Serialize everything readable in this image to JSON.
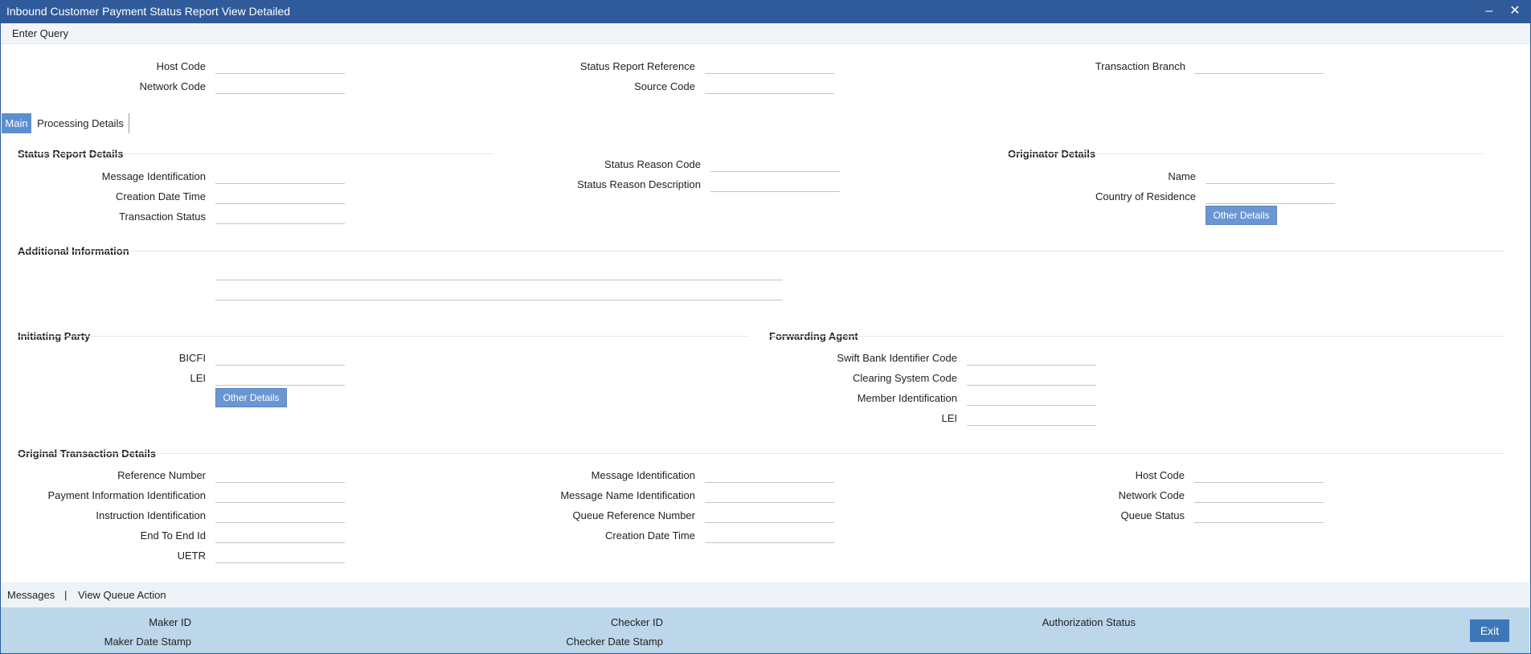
{
  "window": {
    "title": "Inbound Customer Payment Status Report View Detailed",
    "minimize_icon": "minimize-icon",
    "close_icon": "close-icon"
  },
  "menu": {
    "enter_query": "Enter Query"
  },
  "header": {
    "host_code": "Host Code",
    "network_code": "Network Code",
    "status_report_reference": "Status Report Reference",
    "source_code": "Source Code",
    "transaction_branch": "Transaction Branch"
  },
  "tabs": {
    "main": "Main",
    "processing_details": "Processing Details"
  },
  "status_report": {
    "title": "Status Report Details",
    "message_identification": "Message Identification",
    "creation_date_time": "Creation Date Time",
    "transaction_status": "Transaction Status",
    "status_reason_code": "Status Reason Code",
    "status_reason_description": "Status Reason Description"
  },
  "originator": {
    "title": "Originator Details",
    "name": "Name",
    "country_of_residence": "Country of Residence",
    "other_details": "Other Details"
  },
  "additional_information": {
    "title": "Additional Information"
  },
  "initiating_party": {
    "title": "Initiating Party",
    "bicfi": "BICFI",
    "lei": "LEI",
    "other_details": "Other Details"
  },
  "forwarding_agent": {
    "title": "Forwarding Agent",
    "swift_bic": "Swift Bank Identifier Code",
    "clearing_system_code": "Clearing System Code",
    "member_identification": "Member Identification",
    "lei": "LEI"
  },
  "original_transaction": {
    "title": "Original Transaction Details",
    "reference_number": "Reference Number",
    "payment_information_identification": "Payment Information Identification",
    "instruction_identification": "Instruction Identification",
    "end_to_end_id": "End To End Id",
    "uetr": "UETR",
    "message_identification": "Message Identification",
    "message_name_identification": "Message Name Identification",
    "queue_reference_number": "Queue Reference Number",
    "creation_date_time": "Creation Date Time",
    "host_code": "Host Code",
    "network_code": "Network Code",
    "queue_status": "Queue Status"
  },
  "footer_links": {
    "messages": "Messages",
    "separator": "|",
    "view_queue_action": "View Queue Action"
  },
  "audit": {
    "maker_id": "Maker ID",
    "maker_date_stamp": "Maker Date Stamp",
    "checker_id": "Checker ID",
    "checker_date_stamp": "Checker Date Stamp",
    "authorization_status": "Authorization Status",
    "exit": "Exit"
  }
}
